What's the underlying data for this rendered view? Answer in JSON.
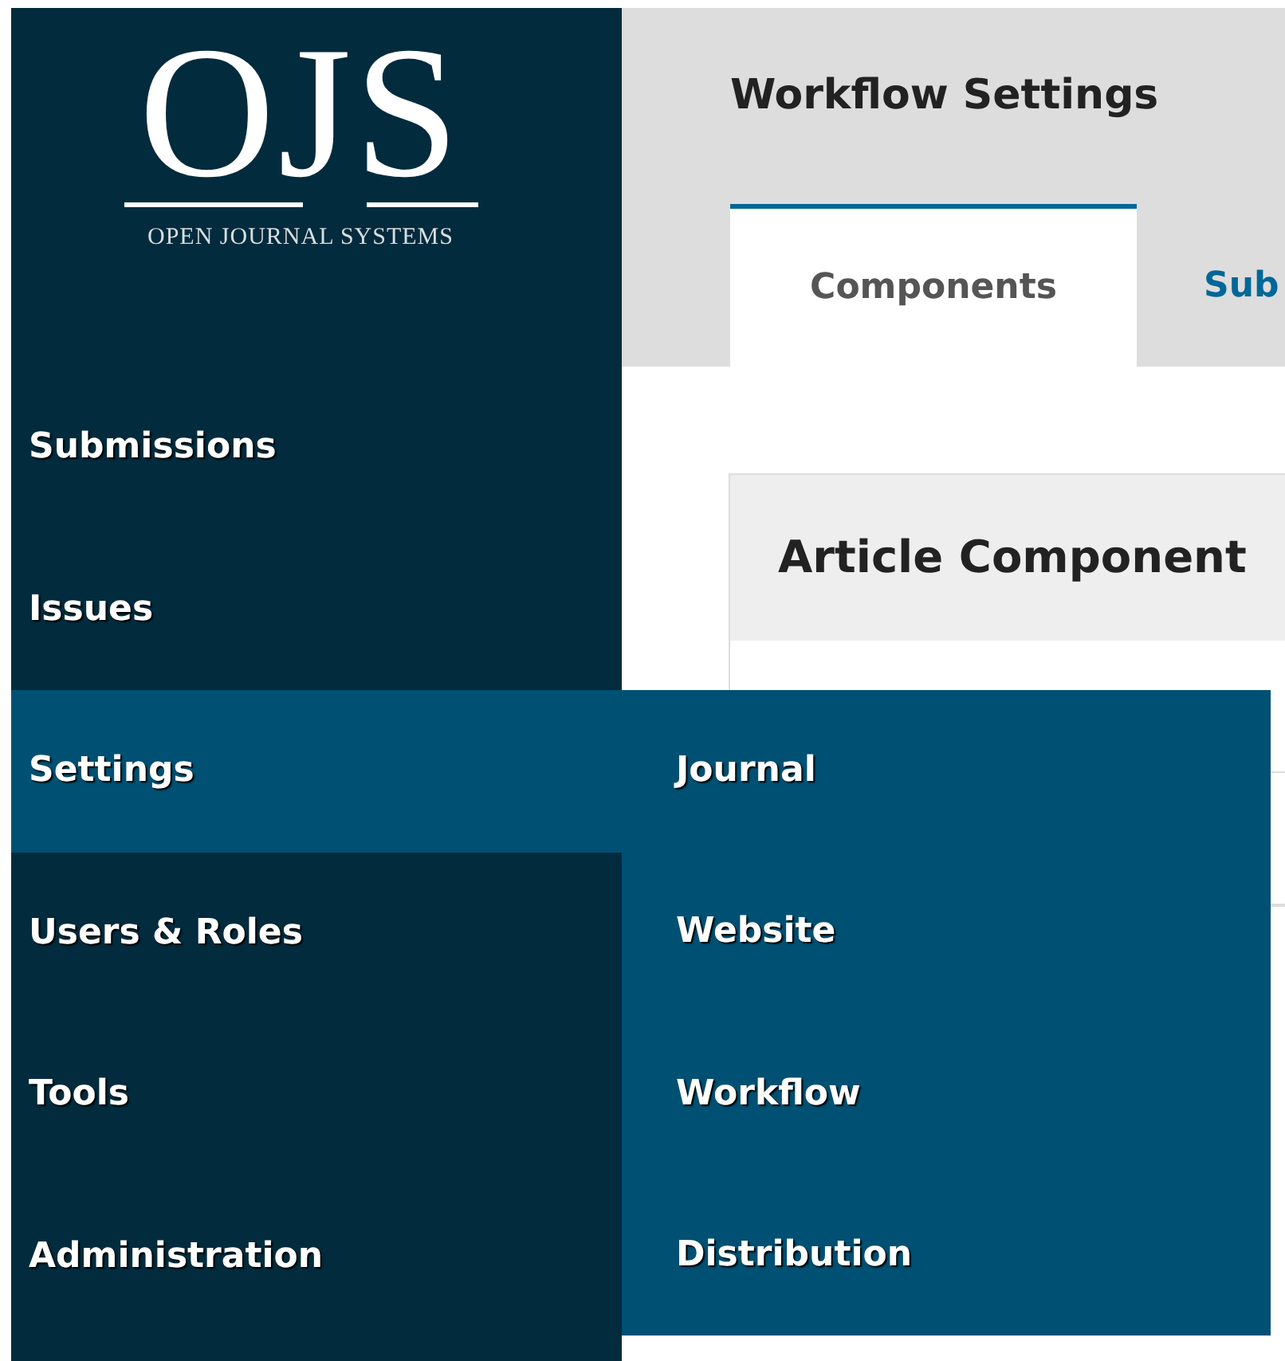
{
  "logo": {
    "mark": "OJS",
    "tagline": "OPEN JOURNAL SYSTEMS"
  },
  "sidebar": {
    "items": [
      {
        "label": "Submissions",
        "selected": false
      },
      {
        "label": "Issues",
        "selected": false
      },
      {
        "label": "Settings",
        "selected": true,
        "submenu": [
          "Journal",
          "Website",
          "Workflow",
          "Distribution"
        ]
      },
      {
        "label": "Users & Roles",
        "selected": false
      },
      {
        "label": "Tools",
        "selected": false
      },
      {
        "label": "Administration",
        "selected": false
      }
    ]
  },
  "page": {
    "title": "Workflow Settings",
    "tabs": [
      {
        "label": "Components",
        "selected": true
      },
      {
        "label": "Sub",
        "selected": false
      }
    ],
    "card": {
      "title": "Article Component"
    }
  }
}
